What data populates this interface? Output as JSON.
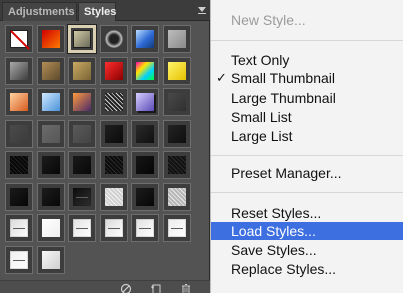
{
  "panel": {
    "tabs": [
      {
        "label": "Adjustments"
      },
      {
        "label": "Styles"
      }
    ],
    "menu_icon": "panel-menu-icon",
    "footer_icons": [
      "no-style-icon",
      "new-style-icon",
      "trash-icon"
    ]
  },
  "styles_grid": {
    "columns": 6,
    "cells": [
      {
        "icon": "no-style",
        "colors": [
          "#ffffff",
          "#cc0000"
        ]
      },
      {
        "icon": "red-glow",
        "colors": [
          "#ff7a00",
          "#d00000"
        ]
      },
      {
        "icon": "selected-bevel",
        "colors": [
          "#6b6b5a",
          "#cfc9a5"
        ],
        "selected": true
      },
      {
        "icon": "chrome-ring",
        "colors": [
          "#222222",
          "#bbbbbb"
        ]
      },
      {
        "icon": "blue-glass",
        "colors": [
          "#2e6ad6",
          "#b8dcff"
        ]
      },
      {
        "icon": "gray-flat",
        "colors": [
          "#8a8a8a",
          "#bdbdbd"
        ]
      },
      {
        "icon": "gray-metal",
        "colors": [
          "#3d3d3d",
          "#a9a9a9"
        ]
      },
      {
        "icon": "bronze",
        "colors": [
          "#5d4a2d",
          "#b48d55"
        ]
      },
      {
        "icon": "gold",
        "colors": [
          "#7a6536",
          "#c9a963"
        ]
      },
      {
        "icon": "red-button",
        "colors": [
          "#8b0000",
          "#ff2d2d"
        ]
      },
      {
        "icon": "rainbow",
        "colors": [
          "#ff00aa",
          "#00d0ff"
        ]
      },
      {
        "icon": "yellow-glow",
        "colors": [
          "#e6c200",
          "#fff46b"
        ]
      },
      {
        "icon": "orange-gradient",
        "colors": [
          "#d65a1f",
          "#ffd2a0"
        ]
      },
      {
        "icon": "sky",
        "colors": [
          "#4c93d8",
          "#cfe8ff"
        ]
      },
      {
        "icon": "sunset",
        "colors": [
          "#4a2a6a",
          "#ff9a3c"
        ]
      },
      {
        "icon": "noise",
        "colors": [
          "#202020",
          "#e0e0e0"
        ]
      },
      {
        "icon": "purple-shadow",
        "colors": [
          "#5a4ab6",
          "#d7cfff"
        ]
      },
      {
        "icon": "dark-flat",
        "colors": [
          "#2f2f2f",
          "#4a4a4a"
        ]
      },
      {
        "icon": "dark-gray",
        "colors": [
          "#3b3b3b",
          "#4b4b4b"
        ]
      },
      {
        "icon": "gray",
        "colors": [
          "#575757",
          "#6b6b6b"
        ]
      },
      {
        "icon": "gray-2",
        "colors": [
          "#444444",
          "#5a5a5a"
        ]
      },
      {
        "icon": "black",
        "colors": [
          "#0b0b0b",
          "#1f1f1f"
        ]
      },
      {
        "icon": "black-2",
        "colors": [
          "#0f0f0f",
          "#2b2b2b"
        ]
      },
      {
        "icon": "black-3",
        "colors": [
          "#0e0e0e",
          "#242424"
        ]
      },
      {
        "icon": "black-speckle",
        "colors": [
          "#050505",
          "#202020"
        ]
      },
      {
        "icon": "black-4",
        "colors": [
          "#070707",
          "#1c1c1c"
        ]
      },
      {
        "icon": "black-5",
        "colors": [
          "#080808",
          "#1a1a1a"
        ]
      },
      {
        "icon": "dark-texture",
        "colors": [
          "#0a0a0a",
          "#2a2a2a"
        ]
      },
      {
        "icon": "black-6",
        "colors": [
          "#050505",
          "#161616"
        ]
      },
      {
        "icon": "dark-grain",
        "colors": [
          "#101010",
          "#2b2b2b"
        ]
      },
      {
        "icon": "black-7",
        "colors": [
          "#060606",
          "#1a1a1a"
        ]
      },
      {
        "icon": "black-8",
        "colors": [
          "#070707",
          "#1d1d1d"
        ]
      },
      {
        "icon": "dark-scratch",
        "colors": [
          "#0c0c0c",
          "#2f2f2f"
        ]
      },
      {
        "icon": "light-speckle",
        "colors": [
          "#d9d9d9",
          "#ffffff"
        ]
      },
      {
        "icon": "black-9",
        "colors": [
          "#060606",
          "#1c1c1c"
        ]
      },
      {
        "icon": "light-grain",
        "colors": [
          "#bfbfbf",
          "#f2f2f2"
        ]
      },
      {
        "icon": "white-scribble",
        "colors": [
          "#d9d9d9",
          "#ffffff"
        ]
      },
      {
        "icon": "white",
        "colors": [
          "#efefef",
          "#ffffff"
        ]
      },
      {
        "icon": "white-lines",
        "colors": [
          "#e2e2e2",
          "#ffffff"
        ]
      },
      {
        "icon": "white-scratch",
        "colors": [
          "#dadada",
          "#ffffff"
        ]
      },
      {
        "icon": "white-dots",
        "colors": [
          "#e0e0e0",
          "#ffffff"
        ]
      },
      {
        "icon": "white-hairline",
        "colors": [
          "#ececec",
          "#ffffff"
        ]
      },
      {
        "icon": "white-line",
        "colors": [
          "#efefef",
          "#ffffff"
        ]
      },
      {
        "icon": "white-noise",
        "colors": [
          "#cfcfcf",
          "#f7f7f7"
        ]
      }
    ]
  },
  "menu": {
    "items": [
      {
        "label": "New Style...",
        "disabled": true
      },
      {
        "label": "Text Only"
      },
      {
        "label": "Small Thumbnail",
        "checked": true
      },
      {
        "label": "Large Thumbnail"
      },
      {
        "label": "Small List"
      },
      {
        "label": "Large List"
      },
      {
        "label": "Preset Manager..."
      },
      {
        "label": "Reset Styles..."
      },
      {
        "label": "Load Styles...",
        "highlighted": true
      },
      {
        "label": "Save Styles..."
      },
      {
        "label": "Replace Styles..."
      }
    ],
    "check_glyph": "✓"
  }
}
